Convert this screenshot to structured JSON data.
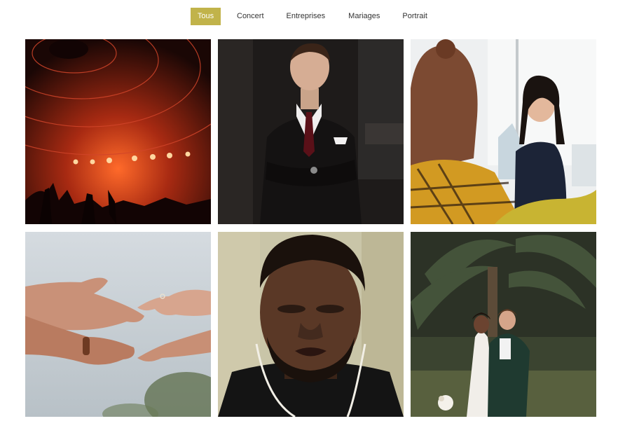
{
  "filters": [
    {
      "label": "Tous",
      "active": true
    },
    {
      "label": "Concert",
      "active": false
    },
    {
      "label": "Entreprises",
      "active": false
    },
    {
      "label": "Mariages",
      "active": false
    },
    {
      "label": "Portrait",
      "active": false
    }
  ],
  "accent_color": "#c1b34a",
  "gallery": [
    {
      "subject": "concert-stage"
    },
    {
      "subject": "businessman-portrait"
    },
    {
      "subject": "office-meeting"
    },
    {
      "subject": "hands-with-ring"
    },
    {
      "subject": "man-portrait-closeup"
    },
    {
      "subject": "wedding-couple"
    }
  ]
}
